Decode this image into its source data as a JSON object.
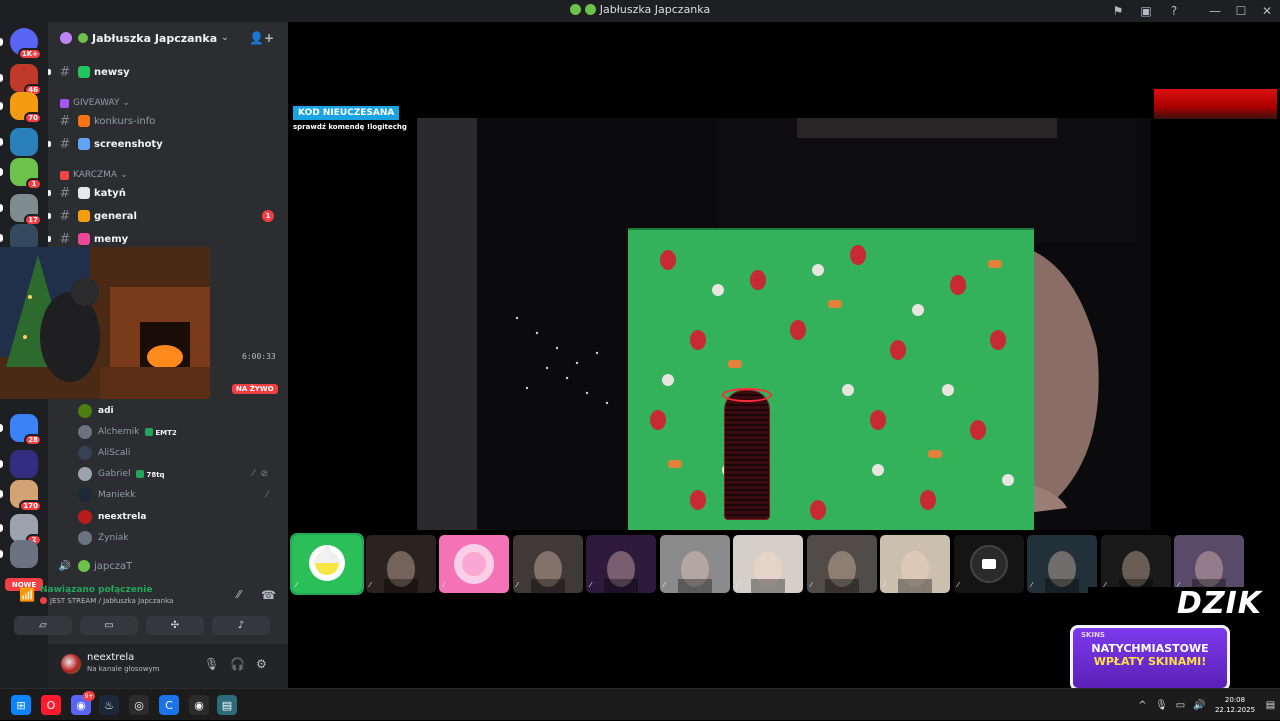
{
  "window": {
    "title": "Jabłuszka Japczanka",
    "icons": [
      "flag-icon",
      "inbox-icon",
      "help-icon"
    ],
    "controls": [
      "minimize",
      "maximize",
      "close"
    ]
  },
  "server_rail": {
    "items": [
      {
        "name": "home",
        "color": "#5865f2",
        "badge": "1K+"
      },
      {
        "name": "server-1",
        "color": "#c0392b",
        "badge": "46"
      },
      {
        "name": "server-2",
        "color": "#f39c12",
        "badge": "70"
      },
      {
        "name": "server-3",
        "color": "#2980b9",
        "badge": ""
      },
      {
        "name": "server-4",
        "color": "#6cc24a",
        "badge": "1"
      },
      {
        "name": "server-5",
        "color": "#7f8c8d",
        "badge": "17"
      },
      {
        "name": "server-6",
        "color": "#34495e",
        "badge": ""
      },
      {
        "name": "server-7",
        "color": "#3b82f6",
        "badge": "28"
      },
      {
        "name": "server-8",
        "color": "#312e81",
        "badge": ""
      },
      {
        "name": "server-9",
        "color": "#d4a373",
        "badge": "170"
      },
      {
        "name": "server-10",
        "color": "#9ca3af",
        "badge": "2"
      },
      {
        "name": "server-11",
        "color": "#6b7280",
        "badge": ""
      }
    ],
    "new_label": "NOWE"
  },
  "guild": {
    "name": "Jabłuszka Japczanka"
  },
  "channels": [
    {
      "type": "text",
      "name": "newsy",
      "emoji_color": "#22c55e",
      "bold": true,
      "unread": true
    },
    {
      "type": "category",
      "name": "GIVEAWAY",
      "emoji_color": "#a855f7"
    },
    {
      "type": "text",
      "name": "konkurs-info",
      "emoji_color": "#f97316",
      "bold": false
    },
    {
      "type": "text",
      "name": "screenshoty",
      "emoji_color": "#60a5fa",
      "bold": true,
      "unread": true
    },
    {
      "type": "category",
      "name": "KARCZMA",
      "emoji_color": "#ef4444"
    },
    {
      "type": "text",
      "name": "katyń",
      "emoji_color": "#e5e7eb",
      "bold": true,
      "unread": true
    },
    {
      "type": "text",
      "name": "general",
      "emoji_color": "#f59e0b",
      "bold": true,
      "unread": true,
      "mentions": "1"
    },
    {
      "type": "text",
      "name": "memy",
      "emoji_color": "#ec4899",
      "bold": true,
      "unread": true
    }
  ],
  "preview": {
    "time": "6:00:33",
    "live_label": "NA ŻYWO"
  },
  "voice_users": [
    {
      "name": "adi",
      "bold": true,
      "avatar": "#4d7c0f",
      "tag": ""
    },
    {
      "name": "Alchemik",
      "bold": false,
      "avatar": "#6b7280",
      "tag": "EMT2"
    },
    {
      "name": "AliScali",
      "bold": false,
      "avatar": "#374151",
      "tag": ""
    },
    {
      "name": "Gabriel",
      "bold": false,
      "avatar": "#9ca3af",
      "tag": "78tq",
      "icons": true
    },
    {
      "name": "Maniekk",
      "bold": false,
      "avatar": "#1f2937",
      "tag": "",
      "deaf": true
    },
    {
      "name": "neextrela",
      "bold": true,
      "avatar": "#b91c1c",
      "tag": ""
    },
    {
      "name": "Zyniak",
      "bold": false,
      "avatar": "#6b7280",
      "tag": ""
    }
  ],
  "voice_channel_2": {
    "name": "japczaT"
  },
  "voice_panel": {
    "status": "Nawiązano połączenie",
    "channel": "JEST STREAM / ",
    "server": "Jabłuszka Japczanka"
  },
  "user": {
    "name": "neextrela",
    "status": "Na kanale głosowym"
  },
  "stream": {
    "code_badge": "KOD NIEUCZESANA",
    "code_sub": "sprawdź komendę !logitechg"
  },
  "tiles": [
    {
      "bg": "#2bbf5a",
      "speaking": true
    },
    {
      "bg": "#2a2320"
    },
    {
      "bg": "#f472b6"
    },
    {
      "bg": "#3f3a38"
    },
    {
      "bg": "#2e1a3d"
    },
    {
      "bg": "#8b8b8b"
    },
    {
      "bg": "#d6cfc7"
    },
    {
      "bg": "#514c48"
    },
    {
      "bg": "#cbbfae"
    },
    {
      "bg": "#141414"
    },
    {
      "bg": "#22303a"
    },
    {
      "bg": "#1a1a1a"
    },
    {
      "bg": "#5a4a6a"
    }
  ],
  "sponsor": {
    "name": "DZIK",
    "brand": "SKINS",
    "line1": "NATYCHMIASTOWE",
    "line2": "WPŁATY SKINAMI!"
  },
  "taskbar": {
    "apps": [
      "windows-start",
      "opera",
      "discord",
      "steam",
      "chrome-like",
      "app-c",
      "steam-alt",
      "notepad"
    ],
    "discord_badge": "9+",
    "time": "20:08",
    "date": "22.12.2025"
  }
}
